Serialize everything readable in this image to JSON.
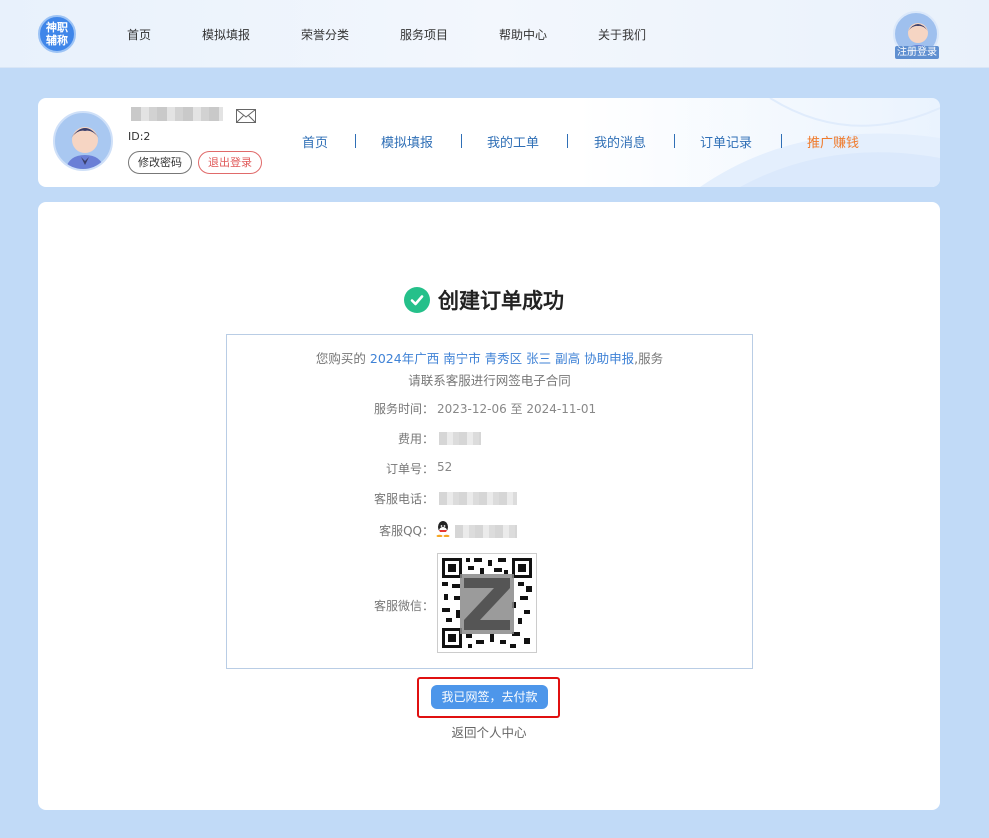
{
  "topnav": {
    "logo_text_1": "神职",
    "logo_text_2": "辅称",
    "items": [
      "首页",
      "模拟填报",
      "荣誉分类",
      "服务项目",
      "帮助中心",
      "关于我们"
    ],
    "avatar_label": "注册登录"
  },
  "profile": {
    "user_id": "ID:2",
    "change_password": "修改密码",
    "logout": "退出登录",
    "subnav": [
      "首页",
      "我的工单",
      "我的消息",
      "订单记录",
      "推广赚钱"
    ],
    "subnav_second": "模拟填报"
  },
  "order": {
    "success_title": "创建订单成功",
    "intro_prefix": "您购买的",
    "service_name": "2024年广西 南宁市 青秀区 张三 副高 协助申报",
    "intro_suffix": ",服务",
    "contact_note": "请联系客服进行网签电子合同",
    "service_time_label": "服务时间：",
    "service_time": "2023-12-06 至 2024-11-01",
    "fee_label": "费用：",
    "order_no_label": "订单号：",
    "order_no": "52",
    "phone_label": "客服电话：",
    "qq_label": "客服QQ：",
    "wechat_label": "客服微信：",
    "pay_button": "我已网签，去付款",
    "back_link": "返回个人中心"
  },
  "colors": {
    "accent": "#4d96ea",
    "link": "#3f82d6",
    "promo": "#f07a2a",
    "success": "#25c08a",
    "highlight_box": "#e01010"
  }
}
